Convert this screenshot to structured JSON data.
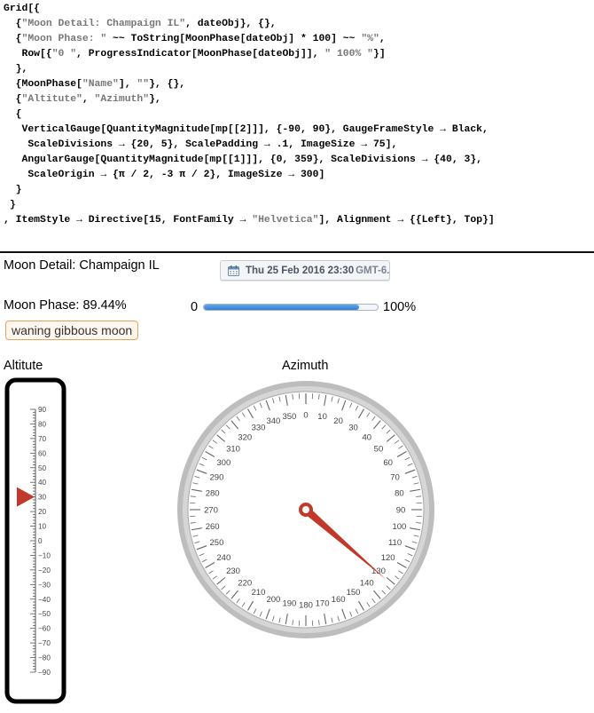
{
  "code": {
    "lines": [
      [
        {
          "t": "Grid[{"
        }
      ],
      [
        {
          "t": "  {"
        },
        {
          "t": "\"Moon Detail: Champaign IL\"",
          "s": 1
        },
        {
          "t": ", dateObj}, {},"
        }
      ],
      [
        {
          "t": "  {"
        },
        {
          "t": "\"Moon Phase: \"",
          "s": 1
        },
        {
          "t": " ~~ ToString[MoonPhase[dateObj] * 100] ~~ "
        },
        {
          "t": "\"%\"",
          "s": 1
        },
        {
          "t": ","
        }
      ],
      [
        {
          "t": "   Row[{"
        },
        {
          "t": "\"0 \"",
          "s": 1
        },
        {
          "t": ", ProgressIndicator[MoonPhase[dateObj]], "
        },
        {
          "t": "\" 100% \"",
          "s": 1
        },
        {
          "t": "}]"
        }
      ],
      [
        {
          "t": "  },"
        }
      ],
      [
        {
          "t": "  {MoonPhase["
        },
        {
          "t": "\"Name\"",
          "s": 1
        },
        {
          "t": "], "
        },
        {
          "t": "\"\"",
          "s": 1
        },
        {
          "t": "}, {},"
        }
      ],
      [
        {
          "t": "  {"
        },
        {
          "t": "\"Altitute\"",
          "s": 1
        },
        {
          "t": ", "
        },
        {
          "t": "\"Azimuth\"",
          "s": 1
        },
        {
          "t": "},"
        }
      ],
      [
        {
          "t": "  {"
        }
      ],
      [
        {
          "t": "   VerticalGauge[QuantityMagnitude[mp[[2]]], {-90, 90}, GaugeFrameStyle → Black,"
        }
      ],
      [
        {
          "t": "    ScaleDivisions → {20, 5}, ScalePadding → .1, ImageSize → 75],"
        }
      ],
      [
        {
          "t": "   AngularGauge[QuantityMagnitude[mp[[1]]], {0, 359}, ScaleDivisions → {40, 3},"
        }
      ],
      [
        {
          "t": "    ScaleOrigin → {π / 2, -3 π / 2}, ImageSize → 300]"
        }
      ],
      [
        {
          "t": "  }"
        }
      ],
      [
        {
          "t": " }"
        }
      ],
      [
        {
          "t": ", ItemStyle → Directive[15, FontFamily → "
        },
        {
          "t": "\"Helvetica\"",
          "s": 1
        },
        {
          "t": "], Alignment → {{Left}, Top}]"
        }
      ]
    ]
  },
  "output": {
    "title": "Moon Detail: Champaign IL",
    "date_main": "Thu 25 Feb 2016 23:30",
    "date_tz": "GMT-6.",
    "calendar_icon": "calendar-icon",
    "phase_label": "Moon Phase: 89.44%",
    "progress_min_label": "0",
    "progress_max_label": "100%",
    "progress_value": 0.8944,
    "phase_name": "waning gibbous moon",
    "altitude_label": "Altitute",
    "azimuth_label": "Azimuth"
  },
  "altitude_gauge": {
    "min": -90,
    "max": 90,
    "value": 30,
    "labels": [
      90,
      80,
      70,
      60,
      50,
      40,
      30,
      20,
      10,
      0,
      -10,
      -20,
      -30,
      -40,
      -50,
      -60,
      -70,
      -80,
      -90
    ],
    "major_step": 10,
    "minor_step": 2,
    "pointer_color": "#c0392b",
    "frame_color": "#000000"
  },
  "azimuth_gauge": {
    "min": 0,
    "max": 359,
    "value": 131,
    "labels": [
      0,
      10,
      20,
      30,
      40,
      50,
      60,
      70,
      80,
      90,
      100,
      110,
      120,
      130,
      140,
      150,
      160,
      170,
      180,
      190,
      200,
      210,
      220,
      230,
      240,
      250,
      260,
      270,
      280,
      290,
      300,
      310,
      320,
      330,
      340,
      350
    ],
    "needle_color": "#c0392b",
    "ring_color": "#bdbdbd"
  },
  "colors": {
    "string_literal": "#777777",
    "progress": "#3b8ee0",
    "badge_border": "#e8a25c"
  }
}
